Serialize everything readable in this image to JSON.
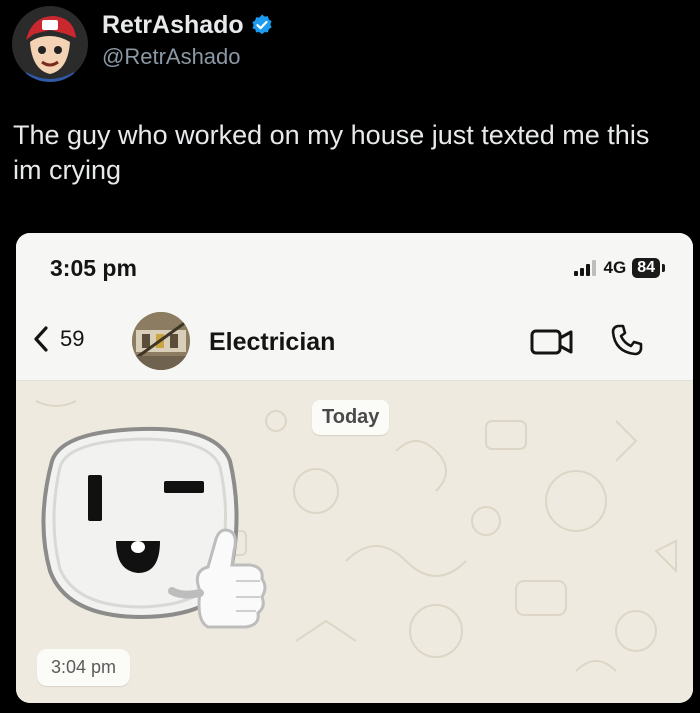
{
  "tweet": {
    "display_name": "RetrAshado",
    "handle": "@RetrAshado",
    "text": "The guy who worked on my house just texted me this im crying"
  },
  "screenshot": {
    "status_bar": {
      "time": "3:05 pm",
      "network": "4G",
      "battery": "84"
    },
    "chat_header": {
      "back_count": "59",
      "contact_name": "Electrician"
    },
    "chat": {
      "date_separator": "Today",
      "message_time": "3:04 pm",
      "message_type": "outlet-thumbs-up-sticker"
    }
  },
  "colors": {
    "verified_badge": "#1d9bf0",
    "tweet_bg": "#000000",
    "chat_bg": "#efeadf"
  }
}
